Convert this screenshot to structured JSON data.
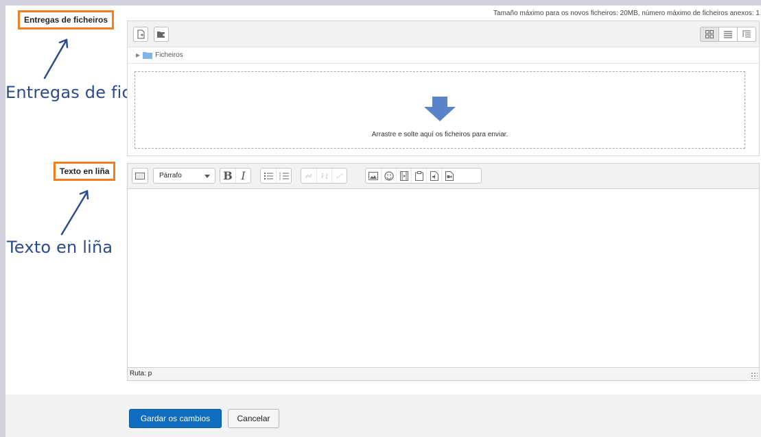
{
  "labels": {
    "file_submissions": "Entregas de ficheiros",
    "online_text": "Texto en liña"
  },
  "annotations": {
    "file_submissions": "Entregas de ficheiros",
    "online_text": "Texto en liña"
  },
  "file_manager": {
    "max_info": "Tamaño máximo para os novos ficheiros: 20MB, número máximo de ficheiros anexos: 1",
    "path_folder": "Ficheiros",
    "drop_text": "Arrastre e solte aquí os ficheiros para enviar."
  },
  "editor": {
    "paragraph_select": "Párrafo",
    "bold": "B",
    "italic": "I",
    "status_path": "Ruta: p"
  },
  "footer": {
    "save_label": "Gardar os cambios",
    "cancel_label": "Cancelar"
  },
  "colors": {
    "label_border": "#f27c22",
    "annotation_ink": "#2d4a8a",
    "primary_button": "#0f6cbf",
    "drop_arrow": "#5b84c8"
  }
}
